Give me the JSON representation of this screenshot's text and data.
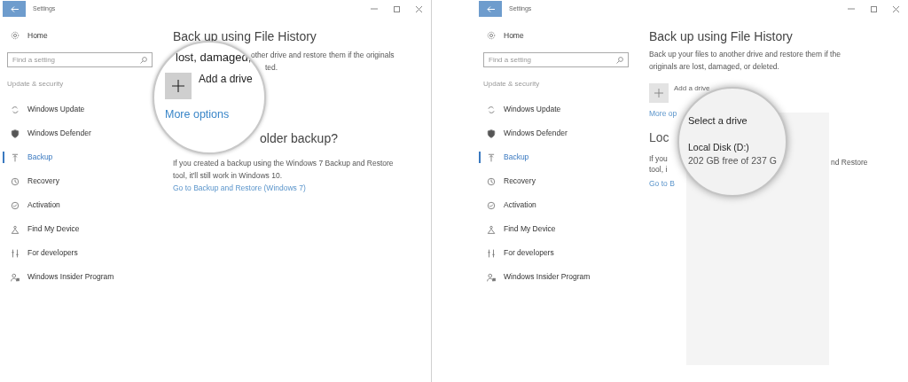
{
  "panels": [
    {
      "kind": "drive-magnified",
      "window": {
        "title": "Settings"
      },
      "sidebar": {
        "home": "Home",
        "search": {
          "placeholder": "Find a setting"
        },
        "section": "Update & security",
        "items": [
          {
            "label": "Windows Update",
            "selected": false
          },
          {
            "label": "Windows Defender",
            "selected": false
          },
          {
            "label": "Backup",
            "selected": true
          },
          {
            "label": "Recovery",
            "selected": false
          },
          {
            "label": "Activation",
            "selected": false
          },
          {
            "label": "Find My Device",
            "selected": false
          },
          {
            "label": "For developers",
            "selected": false
          },
          {
            "label": "Windows Insider Program",
            "selected": false
          }
        ]
      },
      "content": {
        "heading": "Back up using File History",
        "description_lines": [
          "other drive and restore them if the originals",
          "ted."
        ],
        "legacy_heading": "older backup?",
        "legacy_text": "If you created a backup using the Windows 7 Backup and Restore tool, it'll still work in Windows 10.",
        "legacy_link": "Go to Backup and Restore (Windows 7)"
      },
      "magnifier": {
        "text": "lost, damaged,",
        "add_drive": "Add a drive",
        "more_options": "More options"
      }
    },
    {
      "kind": "drive-menu",
      "window": {
        "title": "Settings"
      },
      "sidebar": {
        "home": "Home",
        "search": {
          "placeholder": "Find a setting"
        },
        "section": "Update & security",
        "items": [
          {
            "label": "Windows Update",
            "selected": false
          },
          {
            "label": "Windows Defender",
            "selected": false
          },
          {
            "label": "Backup",
            "selected": true
          },
          {
            "label": "Recovery",
            "selected": false
          },
          {
            "label": "Activation",
            "selected": false
          },
          {
            "label": "Find My Device",
            "selected": false
          },
          {
            "label": "For developers",
            "selected": false
          },
          {
            "label": "Windows Insider Program",
            "selected": false
          }
        ]
      },
      "content": {
        "heading": "Back up using File History",
        "description": "Back up your files to another drive and restore them if the originals are lost, damaged, or deleted.",
        "add_drive": "Add a drive",
        "more_options": "More op",
        "legacy_heading": "Loc",
        "legacy_text_lines": [
          "If you",
          "tool, i"
        ],
        "legacy_text_tail": "nd Restore",
        "legacy_link": "Go to B"
      },
      "magnifier": {
        "title": "Select a drive",
        "drive_name": "Local Disk (D:)",
        "drive_space": "202 GB free of 237 G"
      }
    }
  ]
}
